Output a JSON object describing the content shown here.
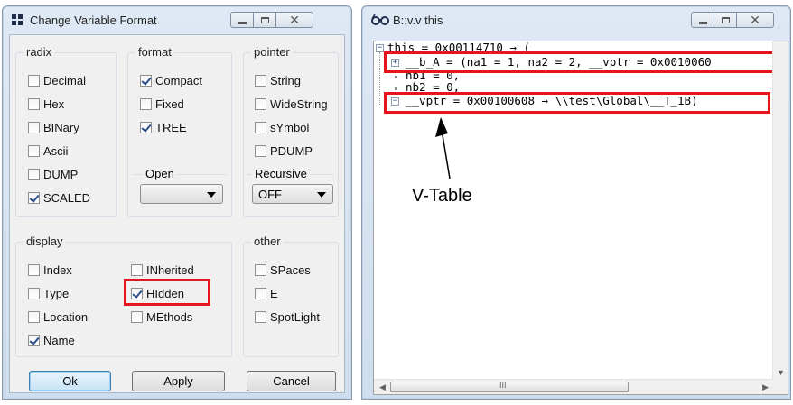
{
  "dialog": {
    "title": "Change Variable Format",
    "icon": "grid-icon",
    "groups": {
      "radix": {
        "legend": "radix",
        "items": [
          {
            "label": "Decimal",
            "checked": false
          },
          {
            "label": "Hex",
            "checked": false
          },
          {
            "label": "BINary",
            "checked": false
          },
          {
            "label": "Ascii",
            "checked": false
          },
          {
            "label": "DUMP",
            "checked": false
          },
          {
            "label": "SCALED",
            "checked": true
          }
        ]
      },
      "format": {
        "legend": "format",
        "items": [
          {
            "label": "Compact",
            "checked": true
          },
          {
            "label": "Fixed",
            "checked": false
          },
          {
            "label": "TREE",
            "checked": true
          }
        ],
        "open_label": "Open",
        "open_value": ""
      },
      "pointer": {
        "legend": "pointer",
        "items": [
          {
            "label": "String",
            "checked": false
          },
          {
            "label": "WideString",
            "checked": false
          },
          {
            "label": "sYmbol",
            "checked": false
          },
          {
            "label": "PDUMP",
            "checked": false
          }
        ],
        "recursive_label": "Recursive",
        "recursive_value": "OFF"
      },
      "display": {
        "legend": "display",
        "items": [
          {
            "label": "Index",
            "checked": false
          },
          {
            "label": "Type",
            "checked": false
          },
          {
            "label": "Location",
            "checked": false
          },
          {
            "label": "Name",
            "checked": true
          },
          {
            "label": "INherited",
            "checked": false
          },
          {
            "label": "HIdden",
            "checked": true
          },
          {
            "label": "MEthods",
            "checked": false
          }
        ]
      },
      "other": {
        "legend": "other",
        "items": [
          {
            "label": "SPaces",
            "checked": false
          },
          {
            "label": "E",
            "checked": false
          },
          {
            "label": "SpotLight",
            "checked": false
          }
        ]
      }
    },
    "buttons": {
      "ok": "Ok",
      "apply": "Apply",
      "cancel": "Cancel"
    }
  },
  "viewer": {
    "title": "B::v.v this",
    "icon": "glasses-icon",
    "lines": [
      "this = 0x00114710 → (",
      "__b_A = (na1 = 1, na2 = 2, __vptr = 0x0010060",
      "nb1 = 0,",
      "nb2 = 0,",
      "__vptr = 0x00100608 → \\\\test\\Global\\__T_1B)"
    ],
    "scroll_h_glyph": "III"
  },
  "annotation": {
    "label": "V-Table"
  },
  "colors": {
    "highlight": "#e8141b",
    "default_button_border": "#3c7fb1",
    "window_frame": "#cfdeee"
  }
}
